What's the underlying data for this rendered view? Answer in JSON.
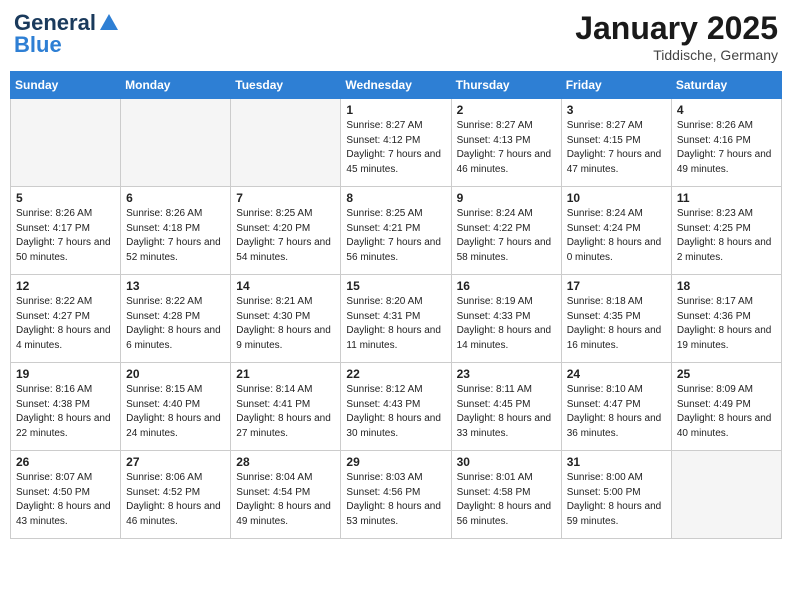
{
  "logo": {
    "line1": "General",
    "line2": "Blue"
  },
  "title": "January 2025",
  "location": "Tiddische, Germany",
  "days_of_week": [
    "Sunday",
    "Monday",
    "Tuesday",
    "Wednesday",
    "Thursday",
    "Friday",
    "Saturday"
  ],
  "weeks": [
    [
      {
        "day": "",
        "info": ""
      },
      {
        "day": "",
        "info": ""
      },
      {
        "day": "",
        "info": ""
      },
      {
        "day": "1",
        "info": "Sunrise: 8:27 AM\nSunset: 4:12 PM\nDaylight: 7 hours and 45 minutes."
      },
      {
        "day": "2",
        "info": "Sunrise: 8:27 AM\nSunset: 4:13 PM\nDaylight: 7 hours and 46 minutes."
      },
      {
        "day": "3",
        "info": "Sunrise: 8:27 AM\nSunset: 4:15 PM\nDaylight: 7 hours and 47 minutes."
      },
      {
        "day": "4",
        "info": "Sunrise: 8:26 AM\nSunset: 4:16 PM\nDaylight: 7 hours and 49 minutes."
      }
    ],
    [
      {
        "day": "5",
        "info": "Sunrise: 8:26 AM\nSunset: 4:17 PM\nDaylight: 7 hours and 50 minutes."
      },
      {
        "day": "6",
        "info": "Sunrise: 8:26 AM\nSunset: 4:18 PM\nDaylight: 7 hours and 52 minutes."
      },
      {
        "day": "7",
        "info": "Sunrise: 8:25 AM\nSunset: 4:20 PM\nDaylight: 7 hours and 54 minutes."
      },
      {
        "day": "8",
        "info": "Sunrise: 8:25 AM\nSunset: 4:21 PM\nDaylight: 7 hours and 56 minutes."
      },
      {
        "day": "9",
        "info": "Sunrise: 8:24 AM\nSunset: 4:22 PM\nDaylight: 7 hours and 58 minutes."
      },
      {
        "day": "10",
        "info": "Sunrise: 8:24 AM\nSunset: 4:24 PM\nDaylight: 8 hours and 0 minutes."
      },
      {
        "day": "11",
        "info": "Sunrise: 8:23 AM\nSunset: 4:25 PM\nDaylight: 8 hours and 2 minutes."
      }
    ],
    [
      {
        "day": "12",
        "info": "Sunrise: 8:22 AM\nSunset: 4:27 PM\nDaylight: 8 hours and 4 minutes."
      },
      {
        "day": "13",
        "info": "Sunrise: 8:22 AM\nSunset: 4:28 PM\nDaylight: 8 hours and 6 minutes."
      },
      {
        "day": "14",
        "info": "Sunrise: 8:21 AM\nSunset: 4:30 PM\nDaylight: 8 hours and 9 minutes."
      },
      {
        "day": "15",
        "info": "Sunrise: 8:20 AM\nSunset: 4:31 PM\nDaylight: 8 hours and 11 minutes."
      },
      {
        "day": "16",
        "info": "Sunrise: 8:19 AM\nSunset: 4:33 PM\nDaylight: 8 hours and 14 minutes."
      },
      {
        "day": "17",
        "info": "Sunrise: 8:18 AM\nSunset: 4:35 PM\nDaylight: 8 hours and 16 minutes."
      },
      {
        "day": "18",
        "info": "Sunrise: 8:17 AM\nSunset: 4:36 PM\nDaylight: 8 hours and 19 minutes."
      }
    ],
    [
      {
        "day": "19",
        "info": "Sunrise: 8:16 AM\nSunset: 4:38 PM\nDaylight: 8 hours and 22 minutes."
      },
      {
        "day": "20",
        "info": "Sunrise: 8:15 AM\nSunset: 4:40 PM\nDaylight: 8 hours and 24 minutes."
      },
      {
        "day": "21",
        "info": "Sunrise: 8:14 AM\nSunset: 4:41 PM\nDaylight: 8 hours and 27 minutes."
      },
      {
        "day": "22",
        "info": "Sunrise: 8:12 AM\nSunset: 4:43 PM\nDaylight: 8 hours and 30 minutes."
      },
      {
        "day": "23",
        "info": "Sunrise: 8:11 AM\nSunset: 4:45 PM\nDaylight: 8 hours and 33 minutes."
      },
      {
        "day": "24",
        "info": "Sunrise: 8:10 AM\nSunset: 4:47 PM\nDaylight: 8 hours and 36 minutes."
      },
      {
        "day": "25",
        "info": "Sunrise: 8:09 AM\nSunset: 4:49 PM\nDaylight: 8 hours and 40 minutes."
      }
    ],
    [
      {
        "day": "26",
        "info": "Sunrise: 8:07 AM\nSunset: 4:50 PM\nDaylight: 8 hours and 43 minutes."
      },
      {
        "day": "27",
        "info": "Sunrise: 8:06 AM\nSunset: 4:52 PM\nDaylight: 8 hours and 46 minutes."
      },
      {
        "day": "28",
        "info": "Sunrise: 8:04 AM\nSunset: 4:54 PM\nDaylight: 8 hours and 49 minutes."
      },
      {
        "day": "29",
        "info": "Sunrise: 8:03 AM\nSunset: 4:56 PM\nDaylight: 8 hours and 53 minutes."
      },
      {
        "day": "30",
        "info": "Sunrise: 8:01 AM\nSunset: 4:58 PM\nDaylight: 8 hours and 56 minutes."
      },
      {
        "day": "31",
        "info": "Sunrise: 8:00 AM\nSunset: 5:00 PM\nDaylight: 8 hours and 59 minutes."
      },
      {
        "day": "",
        "info": ""
      }
    ]
  ]
}
